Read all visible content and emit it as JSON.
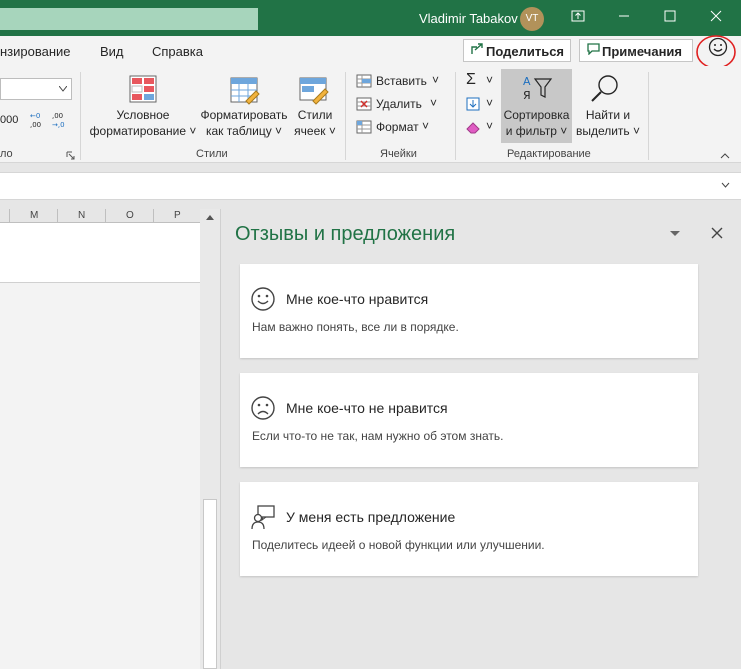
{
  "titlebar": {
    "user_name": "Vladimir Tabakov",
    "avatar_initials": "VT",
    "accent": "#217346"
  },
  "menu": {
    "tabs": [
      "нзирование",
      "Вид",
      "Справка"
    ],
    "share_label": "Поделиться",
    "notes_label": "Примечания"
  },
  "ribbon": {
    "number_group_fragment": "ло",
    "number_format_fragment": "000",
    "conditional_format": [
      "Условное",
      "форматирование"
    ],
    "format_as_table": [
      "Форматировать",
      "как таблицу"
    ],
    "cell_styles": [
      "Стили",
      "ячеек"
    ],
    "styles_group": "Стили",
    "insert": "Вставить",
    "delete": "Удалить",
    "format": "Формат",
    "cells_group": "Ячейки",
    "sort_filter": [
      "Сортировка",
      "и фильтр"
    ],
    "find_select": [
      "Найти и",
      "выделить"
    ],
    "editing_group": "Редактирование"
  },
  "sheet": {
    "columns": [
      "M",
      "N",
      "O",
      "P"
    ]
  },
  "feedback_pane": {
    "title": "Отзывы и предложения",
    "cards": [
      {
        "title": "Мне кое-что нравится",
        "subtitle": "Нам важно понять, все ли в порядке.",
        "icon": "smile-icon"
      },
      {
        "title": "Мне кое-что не нравится",
        "subtitle": "Если что-то не так, нам нужно об этом знать.",
        "icon": "frown-icon"
      },
      {
        "title": "У меня есть предложение",
        "subtitle": "Поделитесь идеей о новой функции или улучшении.",
        "icon": "suggestion-icon"
      }
    ]
  }
}
